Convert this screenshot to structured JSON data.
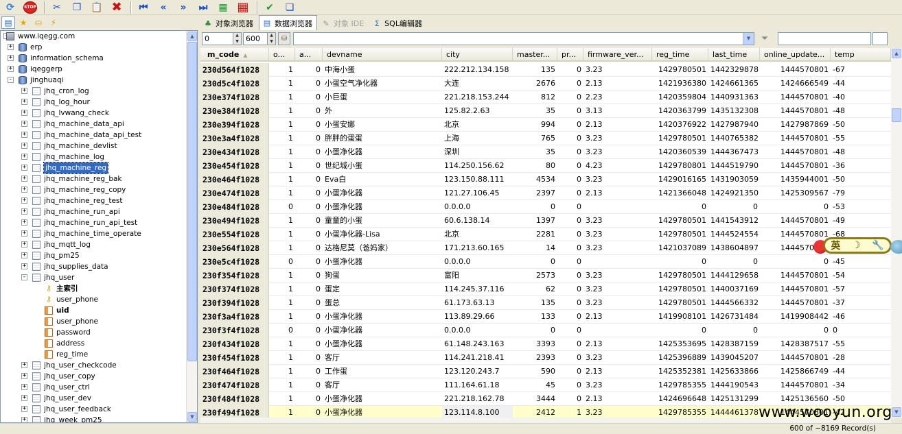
{
  "toolbar": {
    "buttons": [
      {
        "name": "refresh-icon",
        "glyph": "⟳",
        "cls": "ic-refresh"
      },
      {
        "name": "stop-icon",
        "glyph": "STOP",
        "cls": "ic-stop"
      },
      {
        "sep": true
      },
      {
        "name": "scissors-icon",
        "glyph": "✂",
        "cls": "ic-blue"
      },
      {
        "name": "copy-icon",
        "glyph": "❐",
        "cls": "ic-blue"
      },
      {
        "name": "paste-icon",
        "glyph": "📋",
        "cls": "ic-blue"
      },
      {
        "name": "delete-icon",
        "glyph": "✖",
        "cls": "ic-red"
      },
      {
        "sep": true
      },
      {
        "name": "first-record-icon",
        "glyph": "⏮",
        "cls": "ic-blue"
      },
      {
        "name": "prev-page-icon",
        "glyph": "«",
        "cls": "ic-blue"
      },
      {
        "name": "next-page-icon",
        "glyph": "»",
        "cls": "ic-blue"
      },
      {
        "name": "last-record-icon",
        "glyph": "⏭",
        "cls": "ic-blue"
      },
      {
        "name": "insert-row-icon",
        "glyph": "▦",
        "cls": "ic-green"
      },
      {
        "name": "delete-row-icon",
        "glyph": "▦",
        "cls": "ic-red"
      },
      {
        "sep": true
      },
      {
        "name": "save-icon",
        "glyph": "✔",
        "cls": "ic-green"
      },
      {
        "name": "cancel-icon",
        "glyph": "❏",
        "cls": "ic-blue"
      }
    ]
  },
  "left_tabs": [
    "tree-view-icon",
    "favorites-star-icon",
    "history-icon",
    "stats-icon"
  ],
  "tree": [
    {
      "label": "www.iqegg.com",
      "level": 0,
      "icon": "server",
      "exp": "-"
    },
    {
      "label": "erp",
      "level": 1,
      "icon": "db",
      "exp": "+"
    },
    {
      "label": "information_schema",
      "level": 1,
      "icon": "db",
      "exp": "+"
    },
    {
      "label": "iqeggerp",
      "level": 1,
      "icon": "db",
      "exp": "+"
    },
    {
      "label": "jinghuaqi",
      "level": 1,
      "icon": "db",
      "exp": "-"
    },
    {
      "label": "jhq_cron_log",
      "level": 2,
      "icon": "table",
      "exp": "+"
    },
    {
      "label": "jhq_log_hour",
      "level": 2,
      "icon": "table",
      "exp": "+"
    },
    {
      "label": "jhq_lvwang_check",
      "level": 2,
      "icon": "table",
      "exp": "+"
    },
    {
      "label": "jhq_machine_data_api",
      "level": 2,
      "icon": "table",
      "exp": "+"
    },
    {
      "label": "jhq_machine_data_api_test",
      "level": 2,
      "icon": "table",
      "exp": "+"
    },
    {
      "label": "jhq_machine_devlist",
      "level": 2,
      "icon": "table",
      "exp": "+"
    },
    {
      "label": "jhq_machine_log",
      "level": 2,
      "icon": "table",
      "exp": "+"
    },
    {
      "label": "jhq_machine_reg",
      "level": 2,
      "icon": "table",
      "exp": "+",
      "selected": true
    },
    {
      "label": "jhq_machine_reg_bak",
      "level": 2,
      "icon": "table",
      "exp": "+"
    },
    {
      "label": "jhq_machine_reg_copy",
      "level": 2,
      "icon": "table",
      "exp": "+"
    },
    {
      "label": "jhq_machine_reg_test",
      "level": 2,
      "icon": "table",
      "exp": "+"
    },
    {
      "label": "jhq_machine_run_api",
      "level": 2,
      "icon": "table",
      "exp": "+"
    },
    {
      "label": "jhq_machine_run_api_test",
      "level": 2,
      "icon": "table",
      "exp": "+"
    },
    {
      "label": "jhq_machine_time_operate",
      "level": 2,
      "icon": "table",
      "exp": "+"
    },
    {
      "label": "jhq_mqtt_log",
      "level": 2,
      "icon": "table",
      "exp": "+"
    },
    {
      "label": "jhq_pm25",
      "level": 2,
      "icon": "table",
      "exp": "+"
    },
    {
      "label": "jhq_supplies_data",
      "level": 2,
      "icon": "table",
      "exp": "+"
    },
    {
      "label": "jhq_user",
      "level": 2,
      "icon": "table",
      "exp": "-"
    },
    {
      "label": "主索引",
      "level": 3,
      "icon": "key",
      "bold": true
    },
    {
      "label": "user_phone",
      "level": 3,
      "icon": "key"
    },
    {
      "label": "uid",
      "level": 3,
      "icon": "col",
      "bold": true
    },
    {
      "label": "user_phone",
      "level": 3,
      "icon": "col"
    },
    {
      "label": "password",
      "level": 3,
      "icon": "col"
    },
    {
      "label": "address",
      "level": 3,
      "icon": "col"
    },
    {
      "label": "reg_time",
      "level": 3,
      "icon": "col"
    },
    {
      "label": "jhq_user_checkcode",
      "level": 2,
      "icon": "table",
      "exp": "+"
    },
    {
      "label": "jhq_user_copy",
      "level": 2,
      "icon": "table",
      "exp": "+"
    },
    {
      "label": "jhq_user_ctrl",
      "level": 2,
      "icon": "table",
      "exp": "+"
    },
    {
      "label": "jhq_user_dev",
      "level": 2,
      "icon": "table",
      "exp": "+"
    },
    {
      "label": "jhq_user_feedback",
      "level": 2,
      "icon": "table",
      "exp": "+"
    },
    {
      "label": "jhq_week_pm25",
      "level": 2,
      "icon": "table",
      "exp": "+"
    }
  ],
  "tabs": [
    {
      "label": "对象浏览器",
      "icon": "object-browser-icon",
      "glyph": "♣",
      "active": false,
      "disabled": false
    },
    {
      "label": "数据浏览器",
      "icon": "data-browser-icon",
      "glyph": "▤",
      "active": true,
      "disabled": false
    },
    {
      "label": "对象 IDE",
      "icon": "object-ide-icon",
      "glyph": "✎",
      "active": false,
      "disabled": true
    },
    {
      "label": "SQL编辑器",
      "icon": "sql-editor-icon",
      "glyph": "Σ",
      "active": false,
      "disabled": false
    }
  ],
  "filter": {
    "offset": "0",
    "limit": "600",
    "filter_value": "",
    "search_value": ""
  },
  "columns": [
    "m_code",
    "o...",
    "a...",
    "devname",
    "city",
    "master...",
    "pr...",
    "firmware_ver...",
    "reg_time",
    "last_time",
    "online_update...",
    "temp"
  ],
  "rows": [
    [
      "230d564f1028",
      "1",
      "0",
      "中海小蛋",
      "222.212.134.158",
      "135",
      "0",
      "3.23",
      "1429780501",
      "1442329878",
      "1444570801",
      "-67"
    ],
    [
      "230d5c4f1028",
      "1",
      "0",
      "小蛋空气净化器",
      "大连",
      "2676",
      "0",
      "2.13",
      "1421936380",
      "1424661365",
      "1424666549",
      "-44"
    ],
    [
      "230e374f1028",
      "1",
      "0",
      "小巨蛋",
      "221.218.153.244",
      "812",
      "0",
      "2.23",
      "1420359804",
      "1440931363",
      "1444570801",
      "-40"
    ],
    [
      "230e384f1028",
      "1",
      "0",
      "外",
      "125.82.2.63",
      "35",
      "0",
      "3.13",
      "1420363799",
      "1435132308",
      "1444570801",
      "-48"
    ],
    [
      "230e394f1028",
      "1",
      "0",
      "小蛋安娜",
      "北京",
      "994",
      "0",
      "2.13",
      "1420376922",
      "1427987940",
      "1427987869",
      "-50"
    ],
    [
      "230e3a4f1028",
      "1",
      "0",
      "胖胖的蛋蛋",
      "上海",
      "765",
      "0",
      "3.23",
      "1429780501",
      "1440765382",
      "1444570801",
      "-55"
    ],
    [
      "230e434f1028",
      "1",
      "0",
      "小蛋净化器",
      "深圳",
      "35",
      "0",
      "3.23",
      "1420360539",
      "1444367473",
      "1444570801",
      "-48"
    ],
    [
      "230e454f1028",
      "1",
      "0",
      "世纪城小蛋",
      "114.250.156.62",
      "80",
      "0",
      "4.23",
      "1429780801",
      "1444519790",
      "1444570801",
      "-36"
    ],
    [
      "230e464f1028",
      "1",
      "0",
      "Eva白",
      "123.150.88.111",
      "4534",
      "0",
      "3.23",
      "1429016165",
      "1431903059",
      "1435944001",
      "-50"
    ],
    [
      "230e474f1028",
      "1",
      "0",
      "小蛋净化器",
      "121.27.106.45",
      "2397",
      "0",
      "2.13",
      "1421366048",
      "1424921350",
      "1425309567",
      "-79"
    ],
    [
      "230e484f1028",
      "0",
      "0",
      "小蛋净化器",
      "0.0.0.0",
      "0",
      "0",
      "",
      "0",
      "0",
      "0",
      "-53"
    ],
    [
      "230e494f1028",
      "1",
      "0",
      "童童的小蛋",
      "60.6.138.14",
      "1397",
      "0",
      "3.23",
      "1429780501",
      "1441543912",
      "1444570801",
      "-49"
    ],
    [
      "230e554f1028",
      "1",
      "0",
      "小蛋净化器-Lisa",
      "北京",
      "2281",
      "0",
      "3.23",
      "1429780501",
      "1444524554",
      "1444570801",
      "-68"
    ],
    [
      "230e564f1028",
      "1",
      "0",
      "达格尼莫（爸妈家）",
      "171.213.60.165",
      "14",
      "0",
      "3.23",
      "1421037089",
      "1438604897",
      "1444570801",
      "-50"
    ],
    [
      "230e5c4f1028",
      "0",
      "0",
      "小蛋净化器",
      "0.0.0.0",
      "0",
      "0",
      "",
      "0",
      "0",
      "0",
      "-45"
    ],
    [
      "230f354f1028",
      "1",
      "0",
      "狗蛋",
      "富阳",
      "2573",
      "0",
      "3.23",
      "1429780501",
      "1444129658",
      "1444570801",
      "-54"
    ],
    [
      "230f374f1028",
      "1",
      "0",
      "蛋定",
      "114.245.37.116",
      "62",
      "0",
      "3.23",
      "1429780501",
      "1440037169",
      "1444570801",
      "-57"
    ],
    [
      "230f394f1028",
      "1",
      "0",
      "蛋总",
      "61.173.63.13",
      "135",
      "0",
      "3.23",
      "1429780501",
      "1444566332",
      "1444570801",
      "-37"
    ],
    [
      "230f3a4f1028",
      "1",
      "0",
      "小蛋净化器",
      "113.89.29.66",
      "133",
      "0",
      "2.13",
      "1419908101",
      "1426731484",
      "1419908442",
      "-46"
    ],
    [
      "230f3f4f1028",
      "0",
      "0",
      "小蛋净化器",
      "0.0.0.0",
      "0",
      "0",
      "",
      "0",
      "0",
      "0",
      "0"
    ],
    [
      "230f434f1028",
      "1",
      "0",
      "小蛋净化器",
      "61.148.243.163",
      "3393",
      "0",
      "2.13",
      "1425353695",
      "1428387159",
      "1428387517",
      "-55"
    ],
    [
      "230f454f1028",
      "1",
      "0",
      "客厅",
      "114.241.218.41",
      "2393",
      "0",
      "3.23",
      "1425396889",
      "1439045207",
      "1444570801",
      "-28"
    ],
    [
      "230f464f1028",
      "1",
      "0",
      "工作蛋",
      "123.120.243.7",
      "590",
      "0",
      "2.13",
      "1425352381",
      "1425633866",
      "1425866749",
      "-44"
    ],
    [
      "230f474f1028",
      "1",
      "0",
      "客厅",
      "111.164.61.18",
      "45",
      "0",
      "3.23",
      "1429785355",
      "1444190543",
      "1444570801",
      "-34"
    ],
    [
      "230f484f1028",
      "1",
      "0",
      "小蛋净化器",
      "221.218.162.78",
      "3444",
      "0",
      "2.13",
      "1424696648",
      "1425131299",
      "1425136560",
      "-50"
    ],
    [
      "230f494f1028",
      "1",
      "0",
      "小蛋净化器",
      "123.114.8.100",
      "2412",
      "1",
      "3.23",
      "1429785355",
      "1444461378",
      "1444570801",
      "-42"
    ]
  ],
  "status": {
    "records": "600 of ~8169 Record(s)"
  },
  "ime": {
    "label": "英"
  },
  "watermark": "www.wooyun.org"
}
